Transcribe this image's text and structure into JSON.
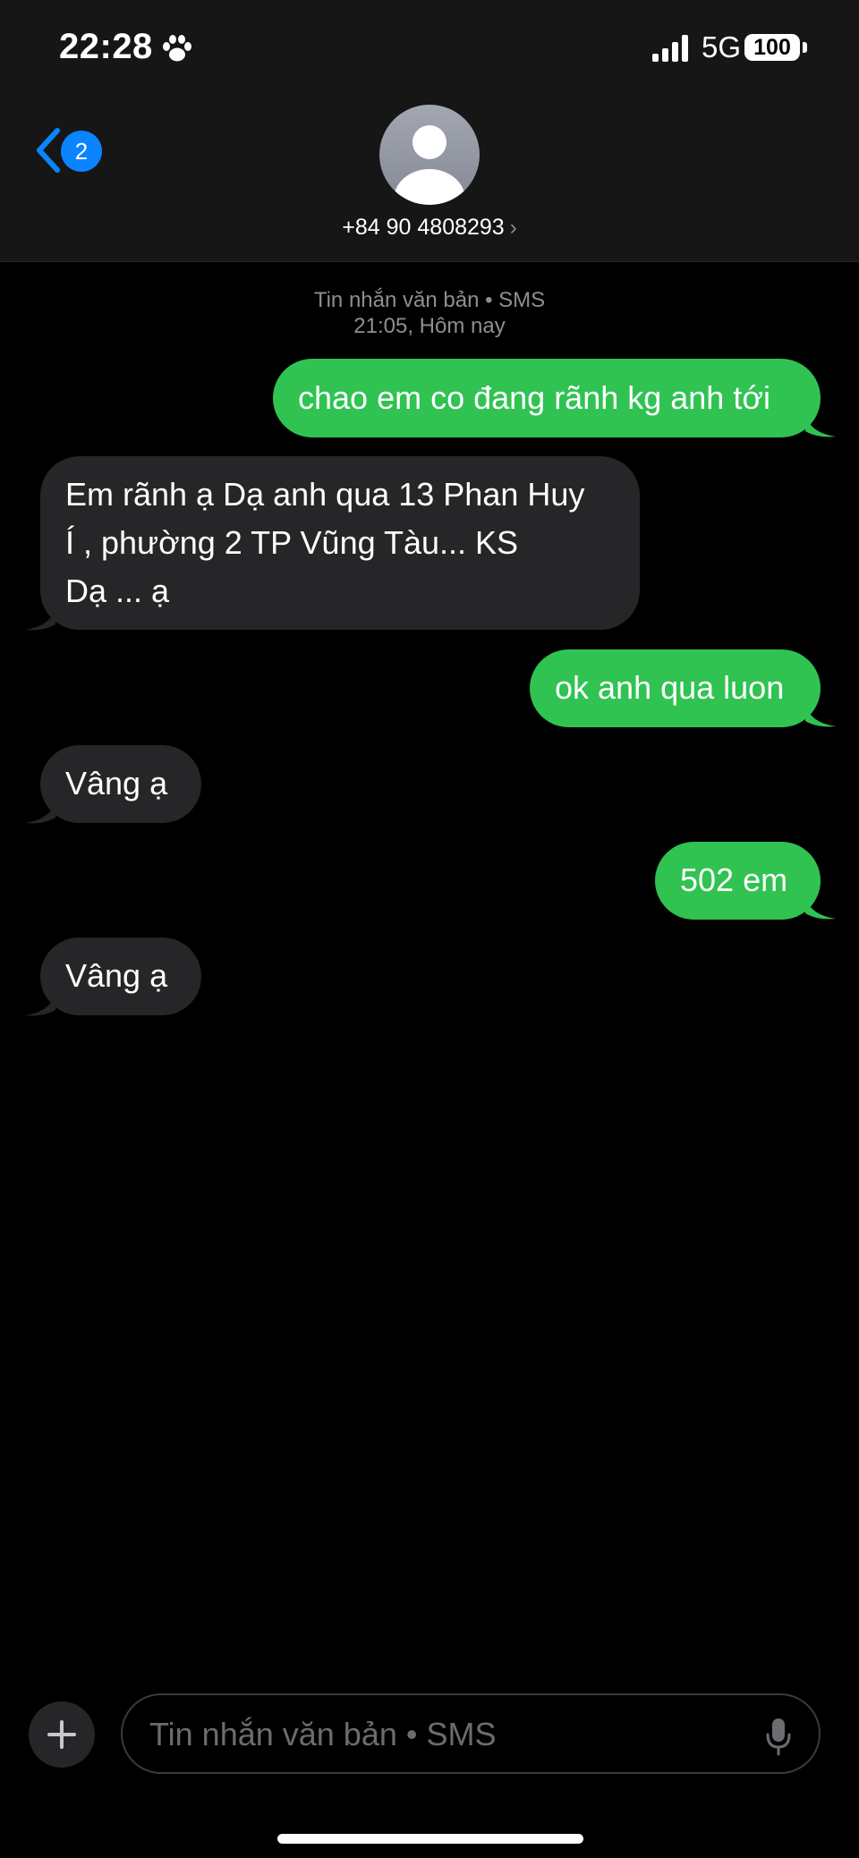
{
  "status_bar": {
    "time": "22:28",
    "network": "5G",
    "battery": "100",
    "icons": [
      "paw-icon",
      "signal-bars-icon",
      "battery-icon"
    ]
  },
  "header": {
    "back_badge": "2",
    "contact": "+84 90 4808293",
    "chevron": "›",
    "icons": [
      "chevron-left-icon",
      "person-avatar-icon"
    ]
  },
  "thread": {
    "service": "Tin nhắn văn bản • SMS",
    "timestamp": "21:05, Hôm nay",
    "messages": [
      {
        "dir": "out",
        "text": "chao em co đang rãnh kg anh tới"
      },
      {
        "dir": "in",
        "lines": [
          "Em rãnh ạ  Dạ anh qua 13 Phan Huy",
          "Í , phường 2 TP Vũng Tàu... KS",
          "Dạ ... ạ"
        ]
      },
      {
        "dir": "out",
        "text": "ok anh qua luon"
      },
      {
        "dir": "in",
        "text": "Vâng ạ"
      },
      {
        "dir": "out",
        "text": "502 em"
      },
      {
        "dir": "in",
        "text": "Vâng ạ"
      }
    ]
  },
  "composer": {
    "placeholder": "Tin nhắn văn bản • SMS",
    "icons": [
      "plus-icon",
      "microphone-icon"
    ]
  },
  "colors": {
    "outgoing_bubble": "#30c352",
    "incoming_bubble": "#262628",
    "accent": "#0a84ff"
  }
}
